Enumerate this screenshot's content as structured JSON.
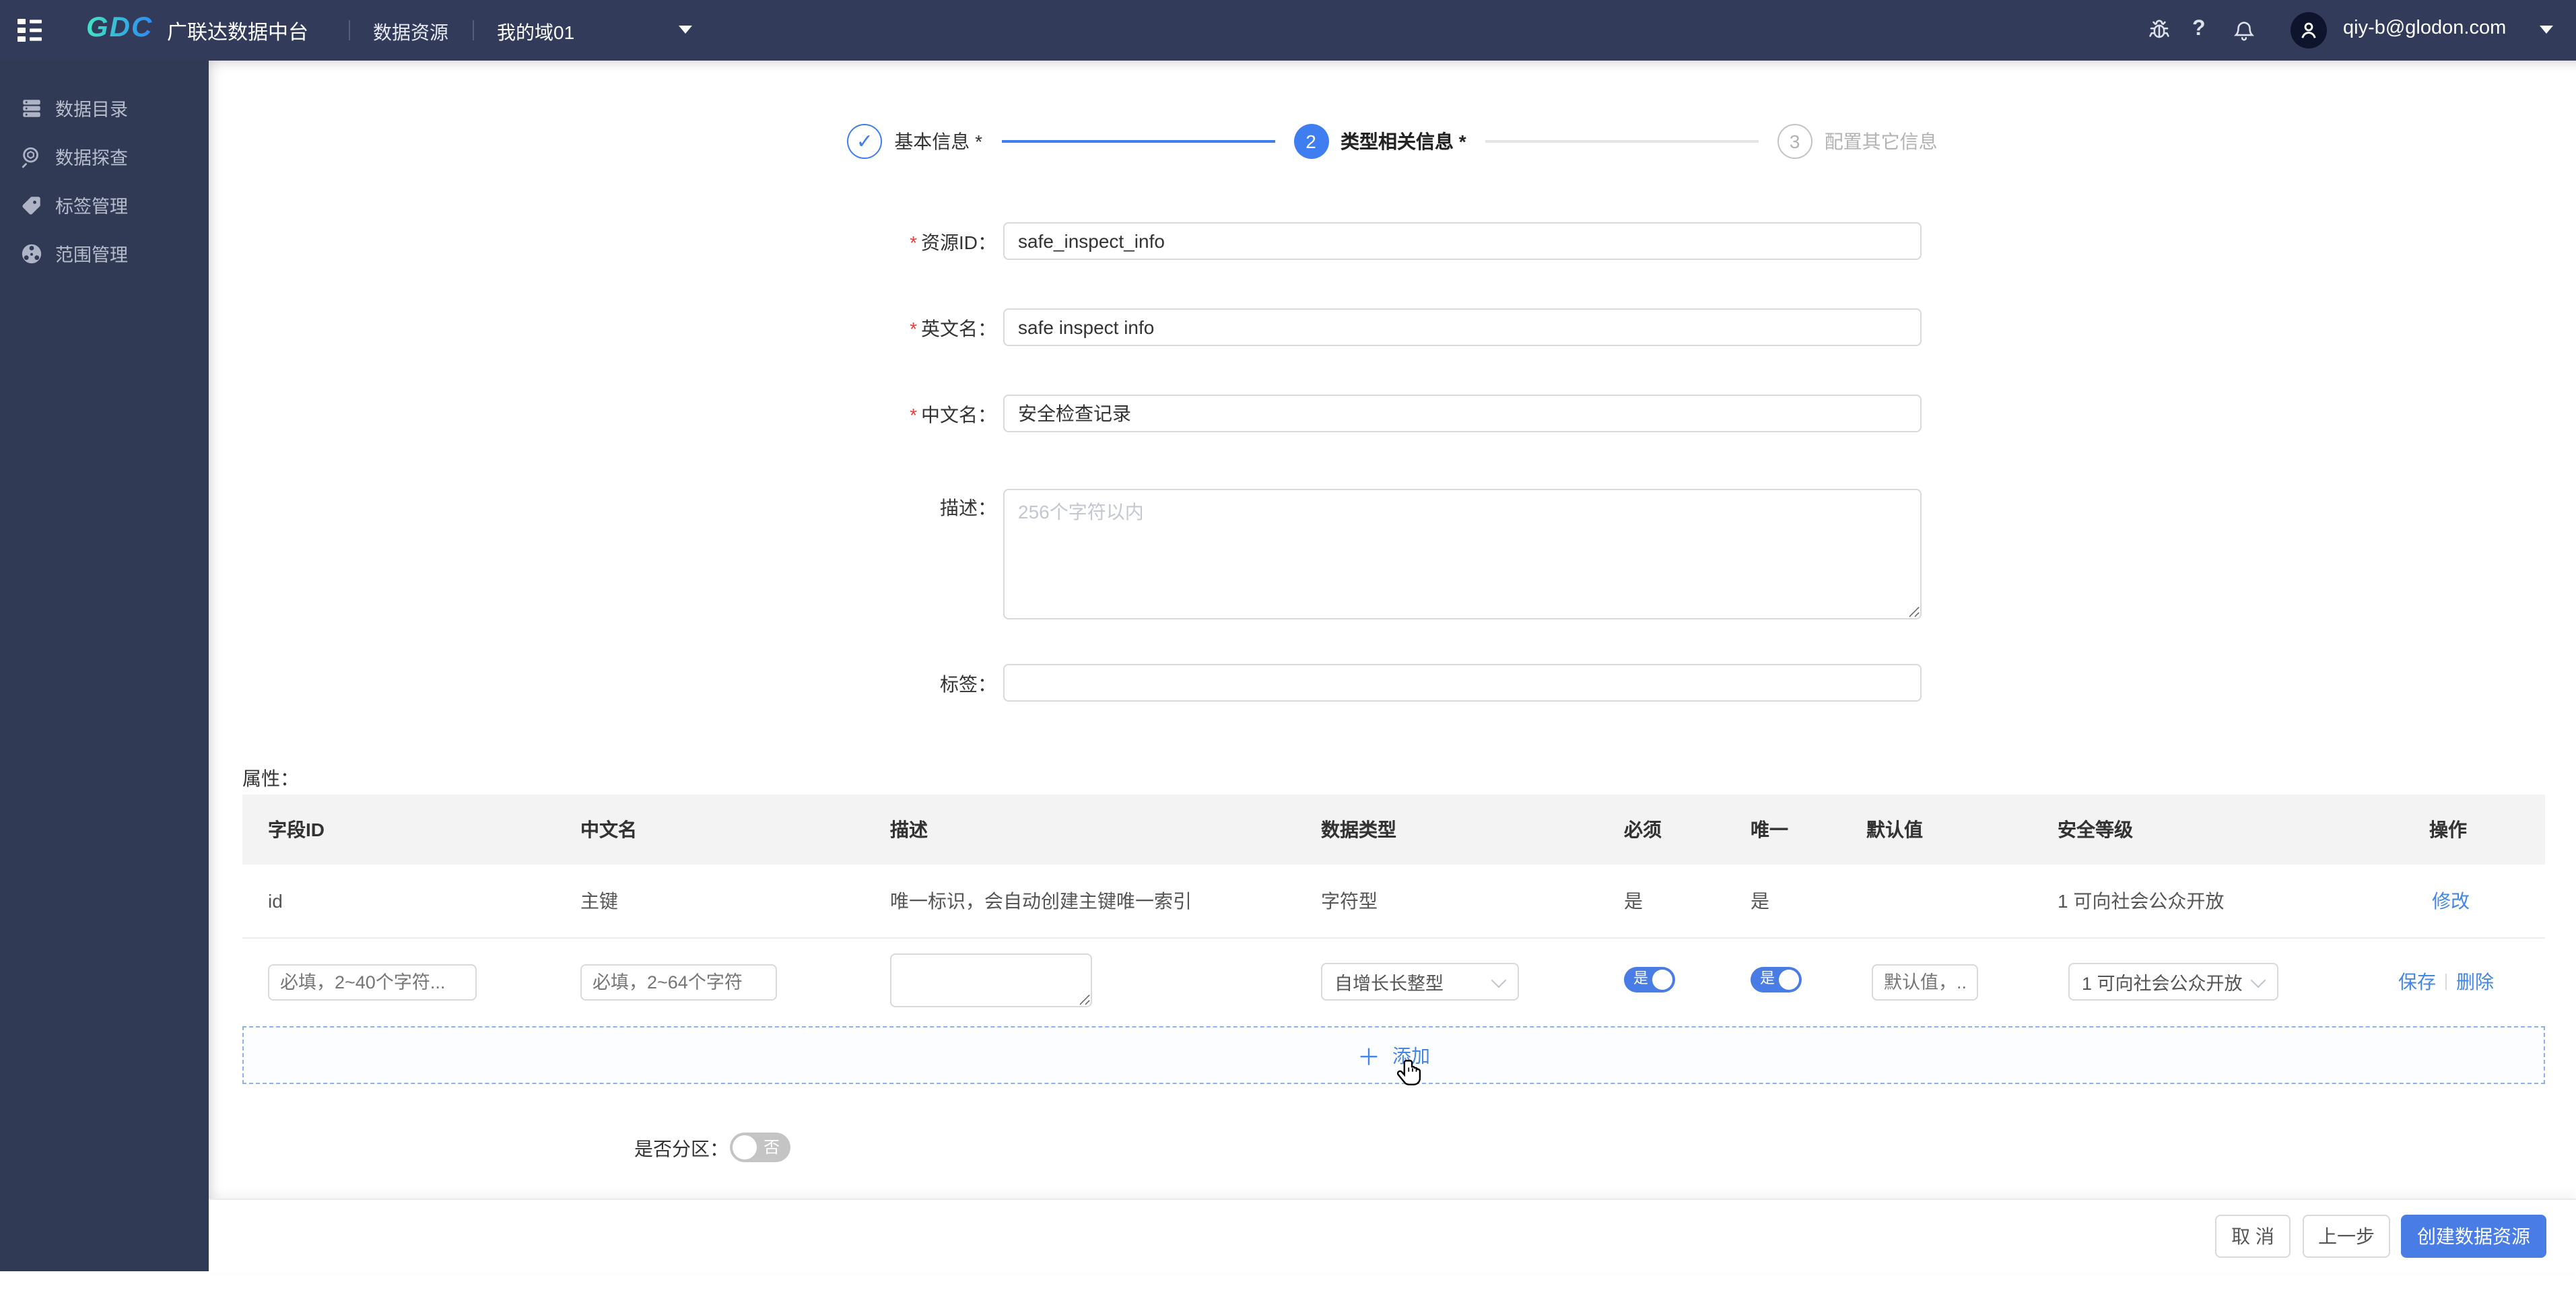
{
  "navbar": {
    "logo": "GDC",
    "title": "广联达数据中台",
    "menu_item": "数据资源",
    "domain_selector": "我的域01",
    "user_email": "qiy-b@glodon.com"
  },
  "sidebar": {
    "items": [
      {
        "label": "数据目录",
        "icon": "data-catalog-icon"
      },
      {
        "label": "数据探查",
        "icon": "data-explore-icon"
      },
      {
        "label": "标签管理",
        "icon": "tag-manage-icon"
      },
      {
        "label": "范围管理",
        "icon": "scope-manage-icon"
      }
    ]
  },
  "steps": [
    {
      "num": "1",
      "label": "基本信息 *",
      "state": "done"
    },
    {
      "num": "2",
      "label": "类型相关信息 *",
      "state": "active"
    },
    {
      "num": "3",
      "label": "配置其它信息",
      "state": "pending"
    }
  ],
  "form": {
    "required_mark": "*",
    "fields": [
      {
        "label": "资源ID：",
        "required": true,
        "value": "safe_inspect_info"
      },
      {
        "label": "英文名：",
        "required": true,
        "value": "safe inspect info"
      },
      {
        "label": "中文名：",
        "required": true,
        "value": "安全检查记录"
      },
      {
        "label": "描述：",
        "required": false,
        "placeholder": "256个字符以内"
      },
      {
        "label": "标签：",
        "required": false,
        "value": ""
      }
    ]
  },
  "attributes": {
    "section_label": "属性：",
    "columns": [
      "字段ID",
      "中文名",
      "描述",
      "数据类型",
      "必须",
      "唯一",
      "默认值",
      "安全等级",
      "操作"
    ],
    "rows": [
      {
        "field_id": "id",
        "cn_name": "主键",
        "description": "唯一标识，会自动创建主键唯一索引",
        "data_type": "字符型",
        "required": "是",
        "unique": "是",
        "default_value": "",
        "security_level": "1 可向社会公众开放",
        "action": "修改"
      }
    ],
    "edit_row": {
      "field_id_placeholder": "必填，2~40个字符...",
      "cn_name_placeholder": "必填，2~64个字符",
      "data_type_value": "自增长长整型",
      "required_toggle": "是",
      "unique_toggle": "是",
      "default_placeholder": "默认值，...",
      "security_value": "1 可向社会公众开放",
      "save_label": "保存",
      "delete_label": "删除"
    },
    "add_label": "添加"
  },
  "partition": {
    "label": "是否分区：",
    "toggle_state_label": "否"
  },
  "footer": {
    "cancel_label": "取 消",
    "prev_label": "上一步",
    "create_label": "创建数据资源"
  },
  "colors": {
    "navbar_bg": "#333b5b",
    "sidebar_bg": "#313a55",
    "accent_blue": "#4a7ce6",
    "link_blue": "#4486e8",
    "step_blue": "#3e7ef0",
    "logo_teal": "#3fe0c5",
    "logo_blue": "#2f8df0",
    "required_red": "#f23a3a",
    "table_header_bg": "#f3f3f3"
  }
}
